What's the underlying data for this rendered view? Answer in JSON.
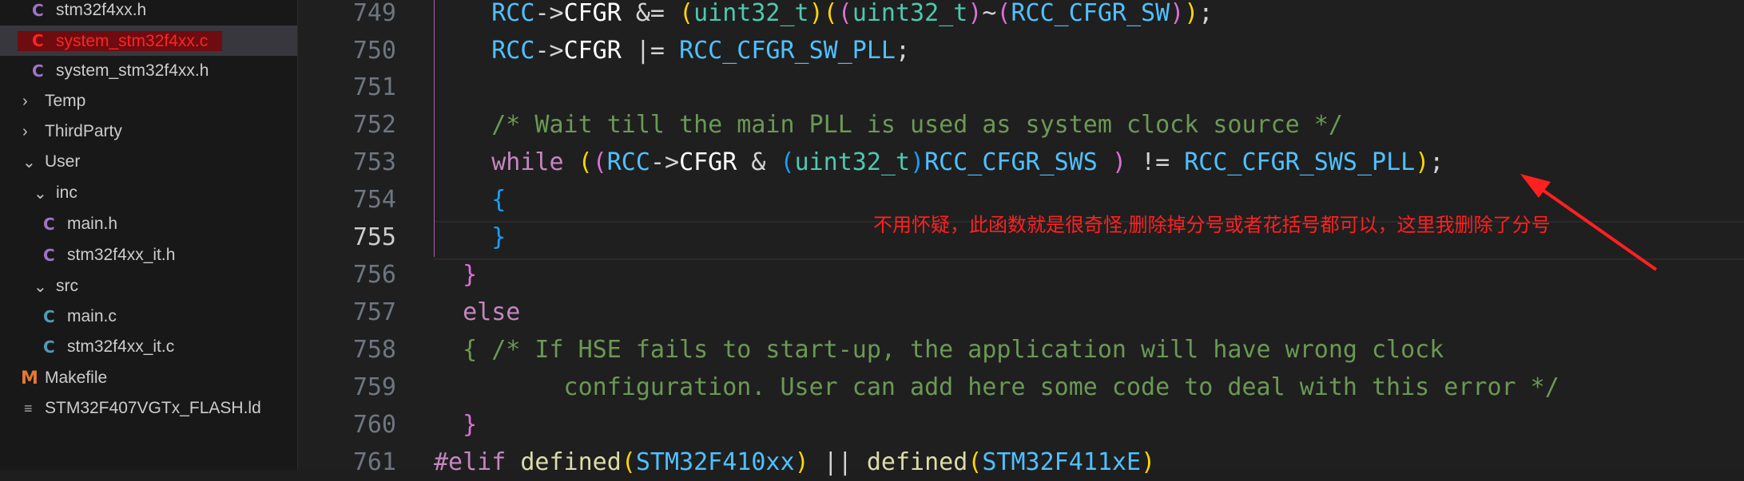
{
  "sidebar": {
    "items": [
      {
        "type": "file-h",
        "label": "stm32f4xx.h"
      },
      {
        "type": "file-c",
        "label": "system_stm32f4xx.c"
      },
      {
        "type": "file-h",
        "label": "system_stm32f4xx.h"
      },
      {
        "type": "folder-collapsed",
        "label": "Temp"
      },
      {
        "type": "folder-collapsed",
        "label": "ThirdParty"
      },
      {
        "type": "folder-expanded",
        "label": "User"
      },
      {
        "type": "folder-expanded",
        "label": "inc"
      },
      {
        "type": "file-h",
        "label": "main.h"
      },
      {
        "type": "file-h",
        "label": "stm32f4xx_it.h"
      },
      {
        "type": "folder-expanded",
        "label": "src"
      },
      {
        "type": "file-c",
        "label": "main.c"
      },
      {
        "type": "file-c",
        "label": "stm32f4xx_it.c"
      },
      {
        "type": "makefile",
        "label": "Makefile"
      },
      {
        "type": "linker",
        "label": "STM32F407VGTx_FLASH.ld"
      }
    ],
    "icon_letters": {
      "c": "C",
      "m": "M",
      "linker": "≡"
    }
  },
  "editor": {
    "lines": [
      {
        "n": "749",
        "text": "    RCC->CFGR &= (uint32_t)((uint32_t)~(RCC_CFGR_SW));"
      },
      {
        "n": "750",
        "text": "    RCC->CFGR |= RCC_CFGR_SW_PLL;"
      },
      {
        "n": "751",
        "text": ""
      },
      {
        "n": "752",
        "text": "    /* Wait till the main PLL is used as system clock source */"
      },
      {
        "n": "753",
        "text": "    while ((RCC->CFGR & (uint32_t)RCC_CFGR_SWS ) != RCC_CFGR_SWS_PLL);"
      },
      {
        "n": "754",
        "text": "    {"
      },
      {
        "n": "755",
        "text": "    }"
      },
      {
        "n": "756",
        "text": "  }"
      },
      {
        "n": "757",
        "text": "  else"
      },
      {
        "n": "758",
        "text": "  { /* If HSE fails to start-up, the application will have wrong clock"
      },
      {
        "n": "759",
        "text": "         configuration. User can add here some code to deal with this error */"
      },
      {
        "n": "760",
        "text": "  }"
      },
      {
        "n": "761",
        "text": "#elif defined(STM32F410xx) || defined(STM32F411xE)"
      }
    ],
    "current_line": "755"
  },
  "annotation": {
    "text": "不用怀疑，此函数就是很奇怪,删除掉分号或者花括号都可以，这里我删除了分号",
    "color": "#ff2020"
  }
}
